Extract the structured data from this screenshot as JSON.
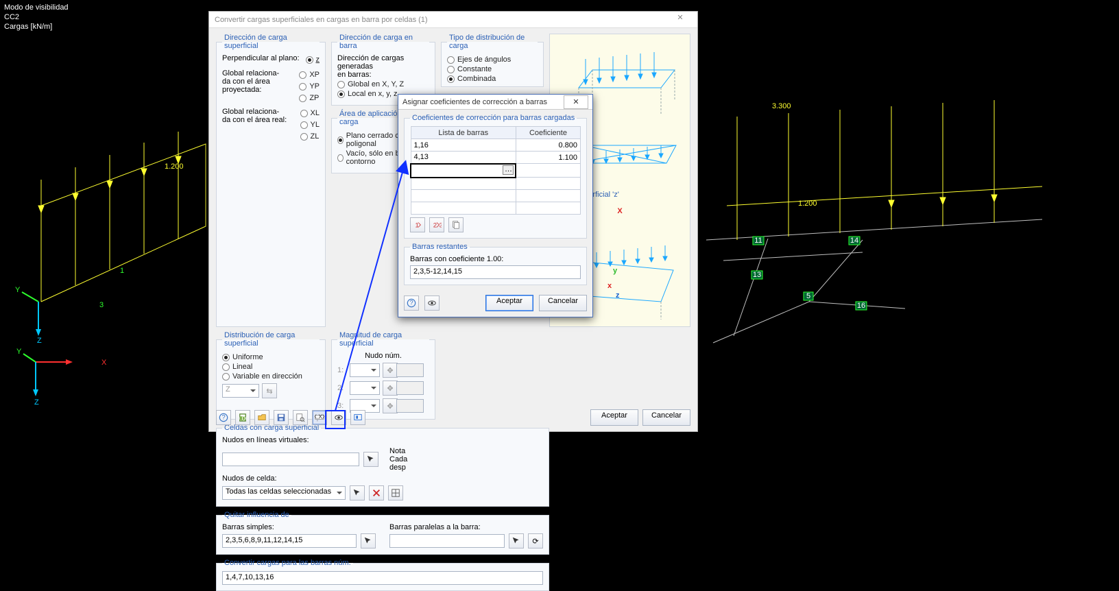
{
  "viewport": {
    "line1": "Modo de visibilidad",
    "line2": "CC2",
    "line3": "Cargas [kN/m]"
  },
  "model_labels": {
    "left_load": "1.200",
    "right_load": "1.200",
    "right_dim": "3.300",
    "m_1": "1",
    "m_3": "3",
    "m_5": "5",
    "m_11": "11",
    "m_13": "13",
    "m_14": "14",
    "m_16": "16"
  },
  "gizmo": {
    "x": "X",
    "y": "Y",
    "z": "Z"
  },
  "dialog": {
    "title": "Convertir cargas superficiales en cargas en barra por celdas   (1)",
    "grp_dir_sup": "Dirección de carga superficial",
    "lbl_perp": "Perpendicular al plano:",
    "rad_z": "z",
    "lbl_glob_proj1": "Global relaciona-",
    "lbl_glob_proj2": "da con el área",
    "lbl_glob_proj3": "proyectada:",
    "rad_XP": "XP",
    "rad_YP": "YP",
    "rad_ZP": "ZP",
    "lbl_glob_real1": "Global relaciona-",
    "lbl_glob_real2": "da con el área real:",
    "rad_XL": "XL",
    "rad_YL": "YL",
    "rad_ZL": "ZL",
    "grp_dir_barra": "Dirección de carga en barra",
    "lbl_dir_gen1": "Dirección de cargas generadas",
    "lbl_dir_gen2": "en barras:",
    "rad_glob_xyz": "Global en X, Y, Z",
    "rad_loc_xyz": "Local en x, y, z",
    "grp_tipo": "Tipo de distribución de carga",
    "rad_ejes": "Ejes de ángulos",
    "rad_const": "Constante",
    "rad_comb": "Combinada",
    "grp_area_aplic": "Área de aplicación de carga",
    "rad_plano": "Plano cerrado contorno poligonal",
    "rad_vacio": "Vacío, sólo en barras de contorno",
    "grp_dist_sup": "Distribución de carga superficial",
    "rad_uni": "Uniforme",
    "rad_lin": "Lineal",
    "rad_vardir": "Variable en dirección",
    "sel_Z": "Z",
    "grp_mag": "Magnitud de carga superficial",
    "lbl_nudo": "Nudo núm.",
    "lbl_1": "1:",
    "lbl_2": "2:",
    "lbl_3": "3:",
    "grp_celdas": "Celdas con carga superficial",
    "lbl_nudos_virtuales": "Nudos en líneas virtuales:",
    "lbl_nudos_celda": "Nudos de celda:",
    "sel_celdas": "Todas las celdas seleccionadas",
    "lbl_nota": "Nota",
    "lbl_cada": "Cada",
    "lbl_desp": "desp",
    "grp_quitar": "Quitar influencia de",
    "lbl_barras_simples": "Barras simples:",
    "lbl_barras_paralelas": "Barras paralelas a la barra:",
    "val_barras_simples": "2,3,5,6,8,9,11,12,14,15",
    "grp_convertir": "Convertir cargas para las barras núm.",
    "val_convertir": "1,4,7,10,13,16",
    "img_caption": "carga superficial 'z'",
    "btn_aceptar": "Aceptar",
    "btn_cancelar": "Cancelar"
  },
  "dialog2": {
    "title": "Asignar coeficientes de corrección a barras",
    "grp_coef": "Coeficientes de corrección para barras cargadas",
    "col_lista": "Lista de barras",
    "col_coef": "Coeficiente",
    "rows": [
      {
        "list": "1,16",
        "coef": "0.800"
      },
      {
        "list": "4,13",
        "coef": "1.100"
      }
    ],
    "grp_rest": "Barras restantes",
    "lbl_rest": "Barras con coeficiente 1.00:",
    "val_rest": "2,3,5-12,14,15",
    "btn_aceptar": "Aceptar",
    "btn_cancelar": "Cancelar"
  },
  "icons": {
    "help": "help-icon",
    "calc": "calculator-icon",
    "open": "open-icon",
    "save": "save-icon",
    "query": "query-icon",
    "xxx": "xxx-icon",
    "eye": "eye-icon",
    "zone": "zone-icon",
    "pick": "pick-icon",
    "arrow": "arrow-icon",
    "delete": "delete-icon",
    "lock": "lock-icon",
    "one": "one-icon",
    "two": "two-icon",
    "page": "page-icon"
  }
}
